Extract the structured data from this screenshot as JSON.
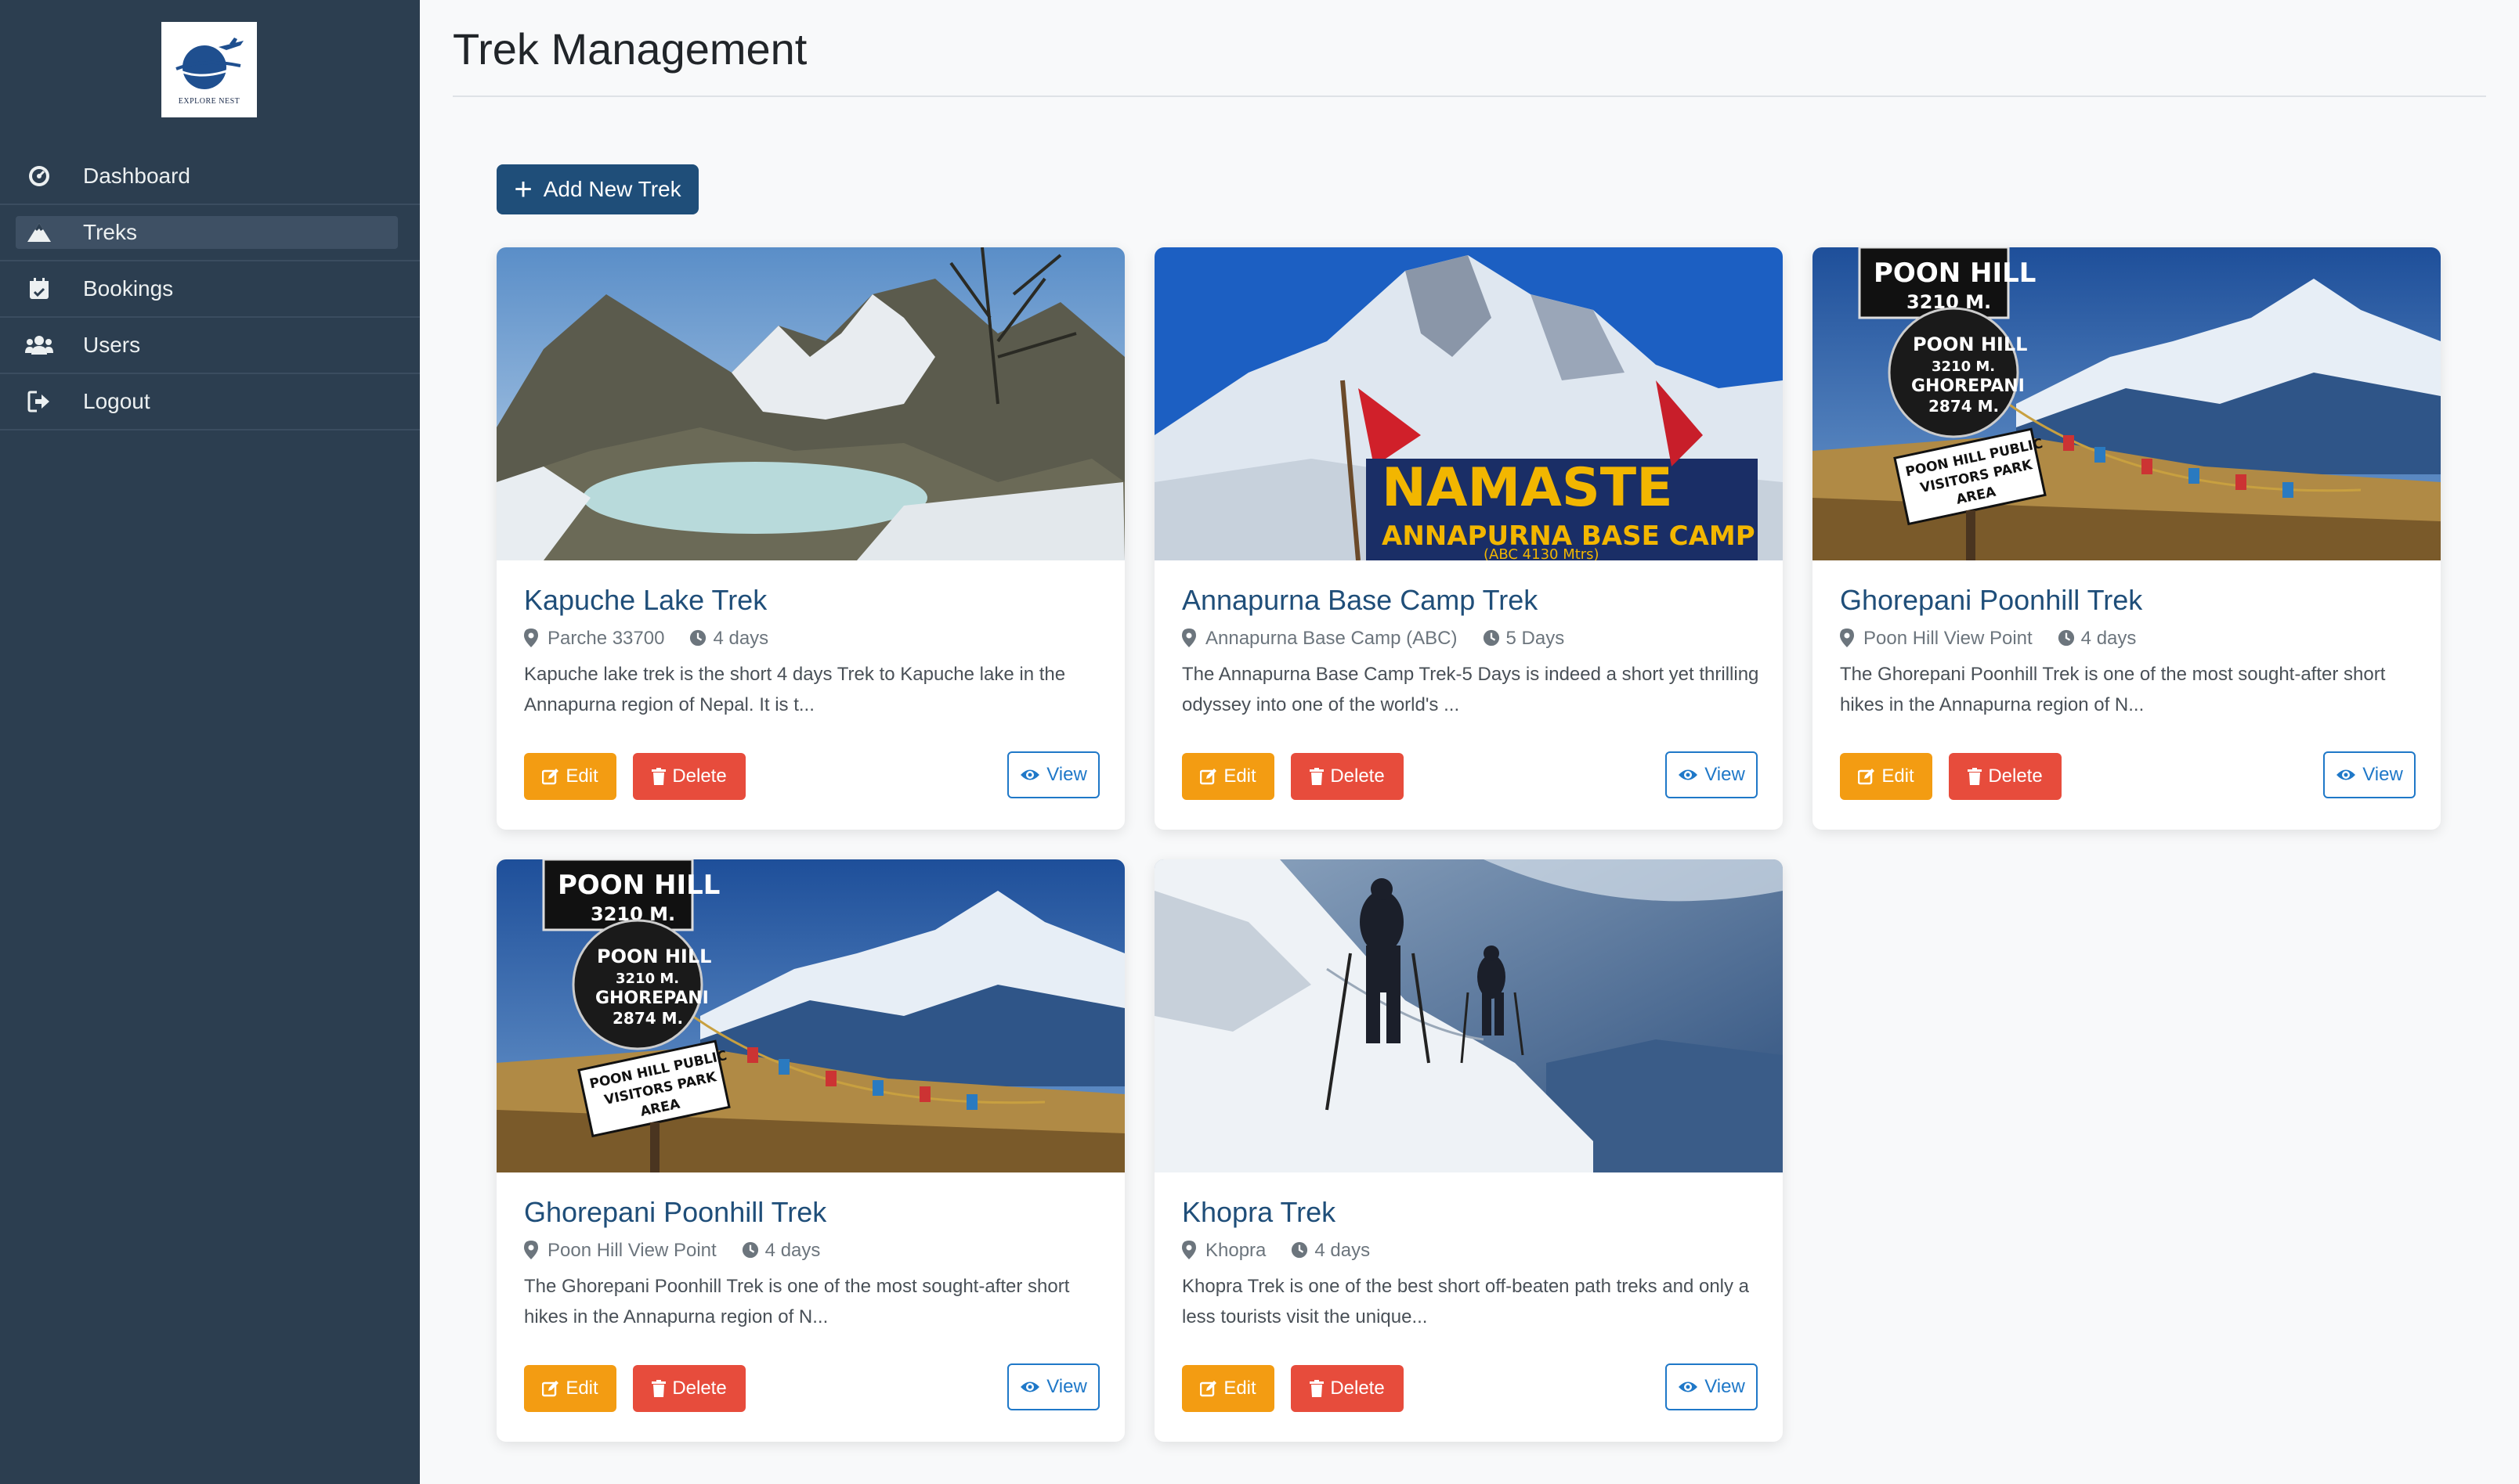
{
  "logo": {
    "text": "EXPLORE NEST"
  },
  "sidebar": {
    "items": [
      {
        "label": "Dashboard",
        "icon": "gauge-icon",
        "active": false
      },
      {
        "label": "Treks",
        "icon": "mountain-icon",
        "active": true
      },
      {
        "label": "Bookings",
        "icon": "calendar-check-icon",
        "active": false
      },
      {
        "label": "Users",
        "icon": "users-icon",
        "active": false
      },
      {
        "label": "Logout",
        "icon": "sign-out-icon",
        "active": false
      }
    ]
  },
  "page": {
    "title": "Trek Management",
    "add_label": "Add New Trek"
  },
  "actions": {
    "edit": "Edit",
    "delete": "Delete",
    "view": "View"
  },
  "treks": [
    {
      "title": "Kapuche Lake Trek",
      "location": "Parche 33700",
      "duration": "4 days",
      "description": "Kapuche lake trek is the short 4 days Trek to Kapuche lake in the Annapurna region of Nepal. It is t...",
      "image": "frozen-lake-photo"
    },
    {
      "title": "Annapurna Base Camp Trek",
      "location": "Annapurna Base Camp (ABC)",
      "duration": "5 Days",
      "description": "The Annapurna Base Camp Trek-5 Days is indeed a short yet thrilling odyssey into one of the world's ...",
      "image": "namaste-sign-photo",
      "sign_text": "NAMASTE",
      "sign_sub": "ANNAPURNA BASE CAMP",
      "sign_small": "(ABC 4130 Mtrs)"
    },
    {
      "title": "Ghorepani Poonhill Trek",
      "location": "Poon Hill View Point",
      "duration": "4 days",
      "description": "The Ghorepani Poonhill Trek is one of the most sought-after short hikes in the Annapurna region of N...",
      "image": "poon-hill-sign-photo",
      "sign_top": "POON HILL",
      "sign_top_sub": "3210 M.",
      "sign_round": [
        "POON HILL",
        "3210 M.",
        "GHOREPANI",
        "2874 M."
      ],
      "sign_bottom": [
        "POON HILL PUBLIC",
        "VISITORS PARK",
        "AREA"
      ]
    },
    {
      "title": "Ghorepani Poonhill Trek",
      "location": "Poon Hill View Point",
      "duration": "4 days",
      "description": "The Ghorepani Poonhill Trek is one of the most sought-after short hikes in the Annapurna region of N...",
      "image": "poon-hill-sign-photo",
      "sign_top": "POON HILL",
      "sign_top_sub": "3210 M.",
      "sign_round": [
        "POON HILL",
        "3210 M.",
        "GHOREPANI",
        "2874 M."
      ],
      "sign_bottom": [
        "POON HILL PUBLIC",
        "VISITORS PARK",
        "AREA"
      ]
    },
    {
      "title": "Khopra Trek",
      "location": "Khopra",
      "duration": "4 days",
      "description": "Khopra Trek is one of the best short off-beaten path treks and only a less tourists visit the unique...",
      "image": "snow-hikers-photo"
    }
  ]
}
